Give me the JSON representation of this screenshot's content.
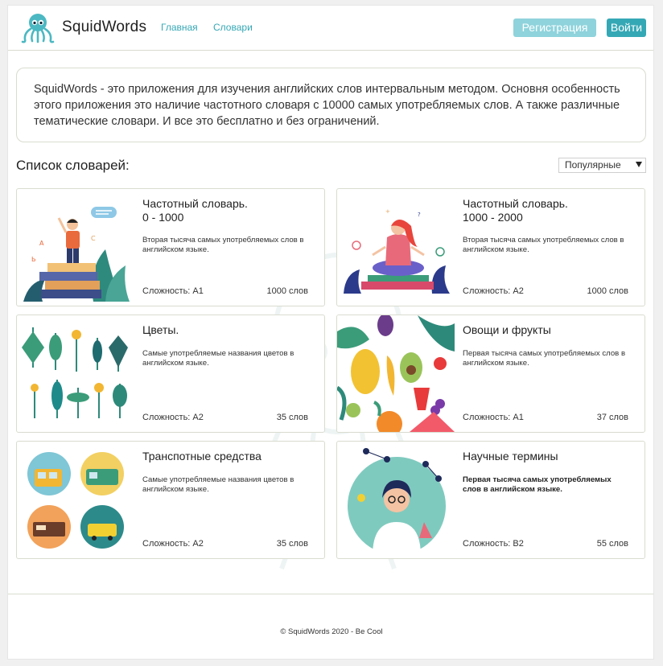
{
  "header": {
    "brand": "SquidWords",
    "nav": [
      {
        "label": "Главная"
      },
      {
        "label": "Словари"
      }
    ],
    "register_label": "Регистрация",
    "login_label": "Войти"
  },
  "intro": {
    "text": "SquidWords - это приложения для изучения английских слов интервальным методом. Основня особенность этого приложения это наличие частотного словаря с 10000 самых употребляемых слов. А также различные тематические словари. И все это бесплатно и без ограничений."
  },
  "list": {
    "title": "Список словарей:",
    "sort_selected": "Популярные"
  },
  "cards": [
    {
      "title": "Частотный словарь.\n0 - 1000",
      "description": "Вторая тысяча самых употребляемых слов в английском языке.",
      "level": "Сложность: A1",
      "count": "1000 слов",
      "image_icon": "boy-on-books-illustration"
    },
    {
      "title": "Частотный словарь.\n1000 - 2000",
      "description": "Вторая тысяча самых употребляемых слов в английском языке.",
      "level": "Сложность: A2",
      "count": "1000 слов",
      "image_icon": "meditating-girl-illustration"
    },
    {
      "title": "Цветы.",
      "description": "Самые употребляемые названия цветов в английском языке.",
      "level": "Сложность: A2",
      "count": "35 слов",
      "image_icon": "flowers-illustration"
    },
    {
      "title": "Овощи и фрукты",
      "description": "Первая тысяча самых употребляемых слов в английском языке.",
      "level": "Сложность: A1",
      "count": "37 слов",
      "image_icon": "fruits-vegetables-illustration"
    },
    {
      "title": "Транспотные средства",
      "description": "Самые употребляемые названия цветов в английском языке.",
      "level": "Сложность: A2",
      "count": "35 слов",
      "image_icon": "transport-illustration"
    },
    {
      "title": "Научные термины",
      "description": "Первая тысяча самых употребляемых слов в английском языке.",
      "level": "Сложность: B2",
      "count": "55 слов",
      "image_icon": "scientist-illustration"
    }
  ],
  "footer": {
    "copyright": "© SquidWords 2020 - Be Cool"
  },
  "colors": {
    "accent": "#35a8b5",
    "accent_light": "#8fd3dc",
    "border": "#d9dccf"
  }
}
